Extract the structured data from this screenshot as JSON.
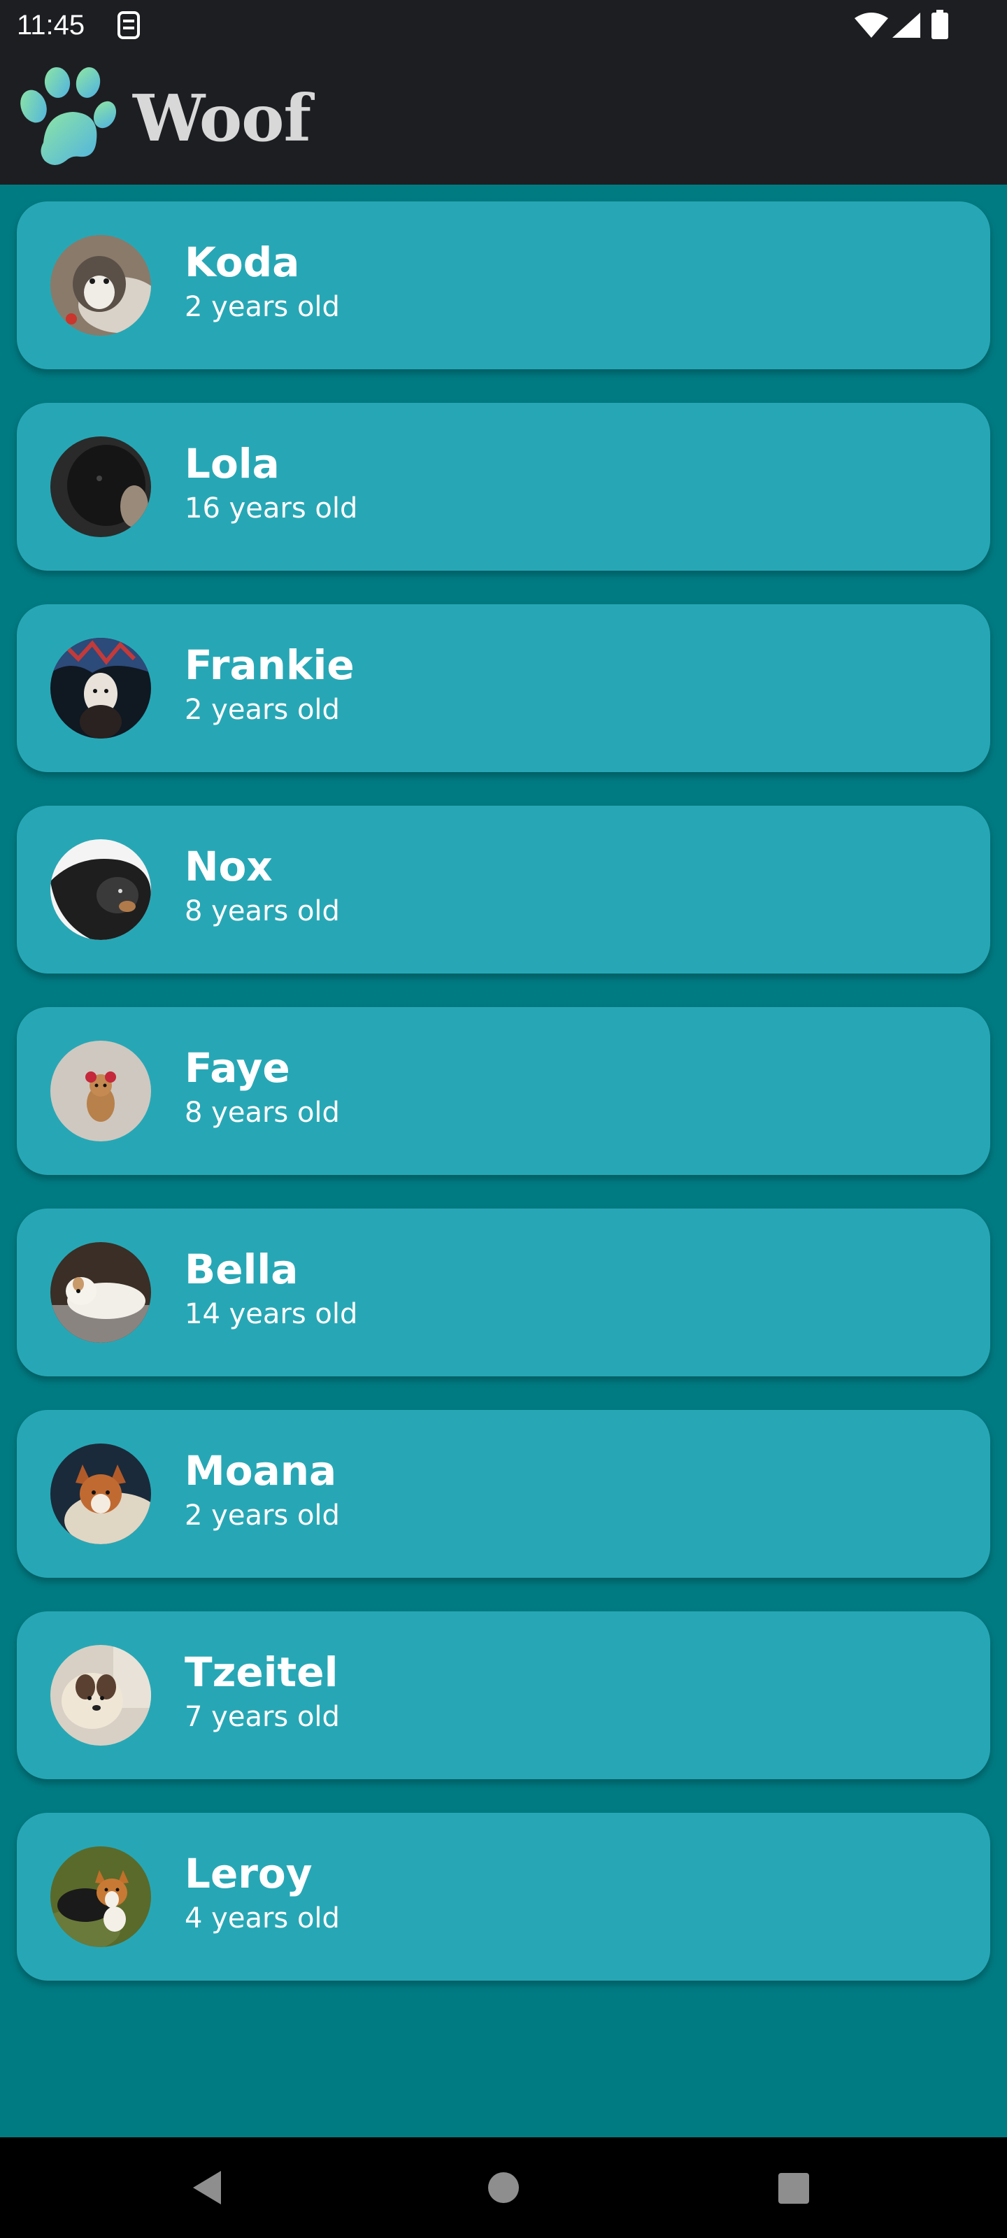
{
  "status_bar": {
    "time": "11:45",
    "icons": [
      "sim-card-icon",
      "wifi-icon",
      "signal-icon",
      "battery-icon"
    ]
  },
  "app_bar": {
    "title": "Woof",
    "logo_icon": "paw-icon"
  },
  "colors": {
    "background": "#017b82",
    "card": "#27a7b5",
    "app_bar": "#1d1e22",
    "text": "#ffffff",
    "title": "#d8d8d8"
  },
  "dogs": [
    {
      "name": "Koda",
      "age": "2 years old"
    },
    {
      "name": "Lola",
      "age": "16 years old"
    },
    {
      "name": "Frankie",
      "age": "2 years old"
    },
    {
      "name": "Nox",
      "age": "8 years old"
    },
    {
      "name": "Faye",
      "age": "8 years old"
    },
    {
      "name": "Bella",
      "age": "14 years old"
    },
    {
      "name": "Moana",
      "age": "2 years old"
    },
    {
      "name": "Tzeitel",
      "age": "7 years old"
    },
    {
      "name": "Leroy",
      "age": "4 years old"
    }
  ],
  "nav_bar": {
    "icons": [
      "back-icon",
      "home-icon",
      "recents-icon"
    ]
  }
}
